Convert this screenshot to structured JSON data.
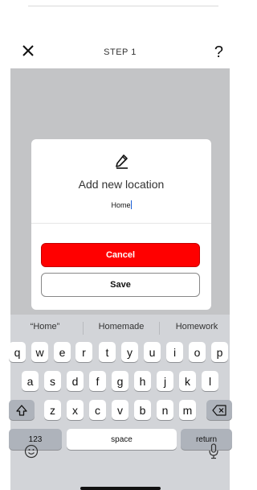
{
  "header": {
    "title": "STEP 1",
    "help_label": "?"
  },
  "dialog": {
    "title": "Add new location",
    "input_value": "Home",
    "cancel_label": "Cancel",
    "save_label": "Save",
    "icon": "pencil-icon"
  },
  "keyboard": {
    "suggestions": [
      "“Home”",
      "Homemade",
      "Homework"
    ],
    "row1": [
      "q",
      "w",
      "e",
      "r",
      "t",
      "y",
      "u",
      "i",
      "o",
      "p"
    ],
    "row2": [
      "a",
      "s",
      "d",
      "f",
      "g",
      "h",
      "j",
      "k",
      "l"
    ],
    "row3": [
      "z",
      "x",
      "c",
      "v",
      "b",
      "n",
      "m"
    ],
    "numbers_label": "123",
    "space_label": "space",
    "return_label": "return"
  },
  "colors": {
    "accent": "#ff0000",
    "overlay": "#c3c4c6",
    "keyboard_bg": "#d2d4d8"
  }
}
